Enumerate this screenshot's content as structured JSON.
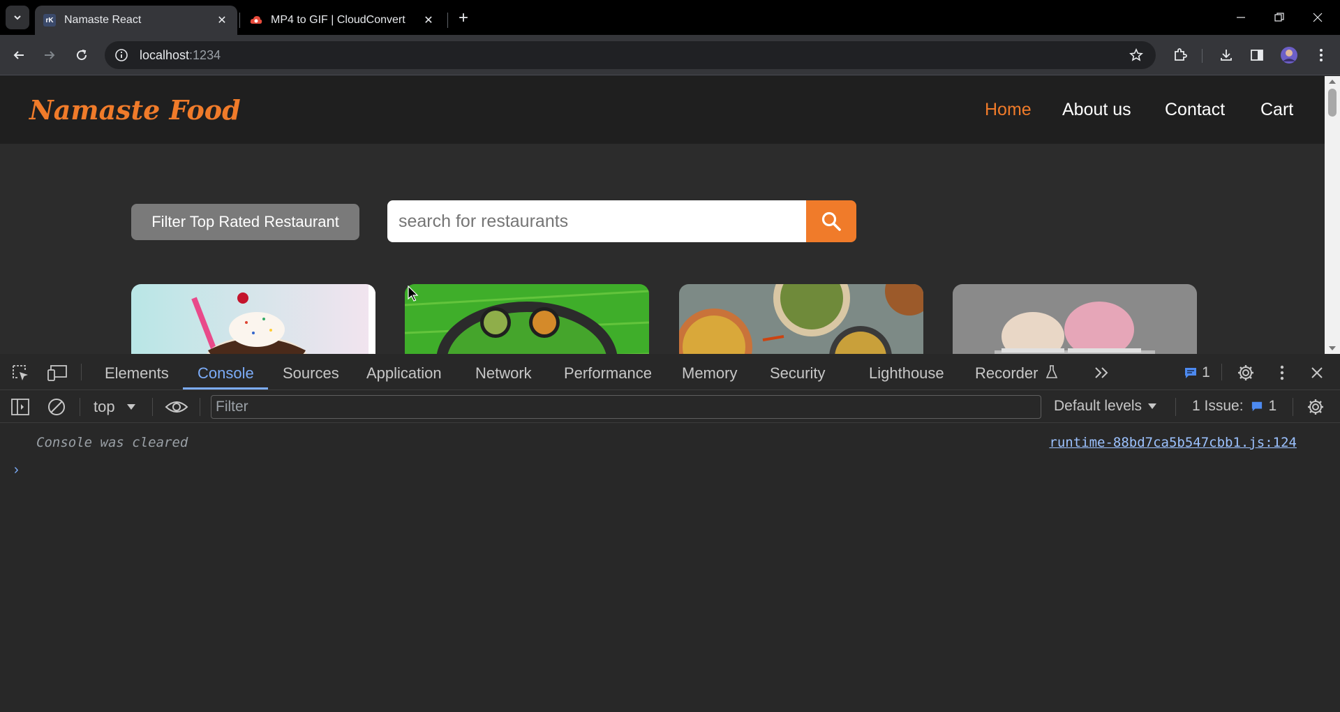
{
  "browser": {
    "tabs": [
      {
        "title": "Namaste React",
        "favicon": "rk-icon",
        "active": true
      },
      {
        "title": "MP4 to GIF | CloudConvert",
        "favicon": "cloudconvert-icon",
        "active": false
      }
    ],
    "address": {
      "host": "localhost",
      "port": ":1234"
    }
  },
  "site": {
    "logo": "Namaste Food",
    "nav": [
      "Home",
      "About us",
      "Contact",
      "Cart"
    ],
    "filter_button": "Filter Top Rated Restaurant",
    "search_placeholder": "search for restaurants",
    "accent": "#f07b2a"
  },
  "devtools": {
    "tabs": [
      "Elements",
      "Console",
      "Sources",
      "Application",
      "Network",
      "Performance",
      "Memory",
      "Security",
      "Lighthouse",
      "Recorder"
    ],
    "active_tab": "Console",
    "message_badge": "1",
    "context": "top",
    "filter_placeholder": "Filter",
    "levels": "Default levels",
    "issues_label": "1 Issue:",
    "issues_count": "1",
    "console_message": "Console was cleared",
    "console_source": "runtime-88bd7ca5b547cbb1.js:124"
  }
}
